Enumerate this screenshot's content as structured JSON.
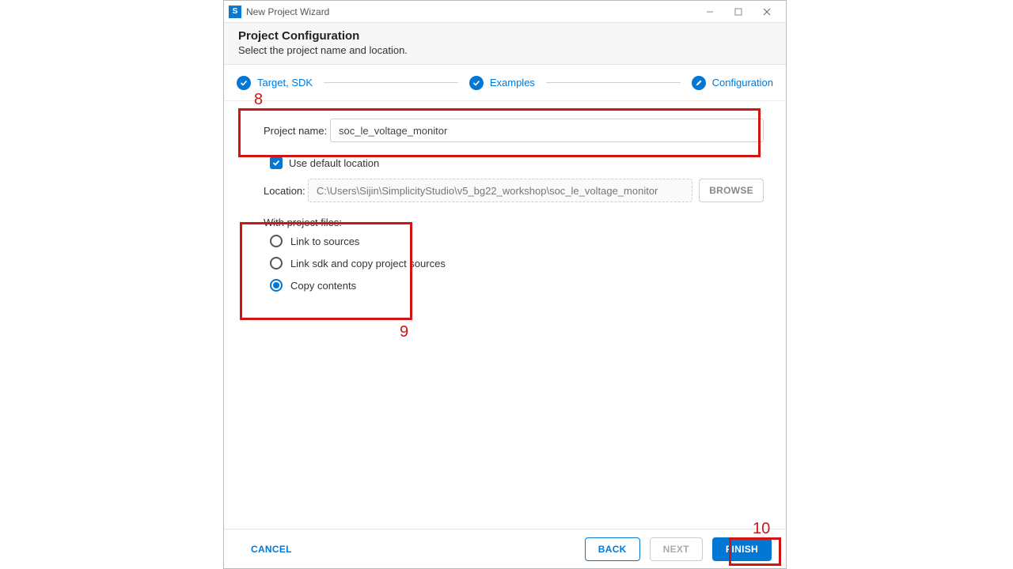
{
  "window": {
    "title": "New Project Wizard"
  },
  "header": {
    "title": "Project Configuration",
    "subtitle": "Select the project name and location."
  },
  "stepper": {
    "step1": "Target, SDK",
    "step2": "Examples",
    "step3": "Configuration"
  },
  "form": {
    "project_name_label": "Project name:",
    "project_name_value": "soc_le_voltage_monitor",
    "use_default_location_label": "Use default location",
    "use_default_location_checked": true,
    "location_label": "Location:",
    "location_value": "C:\\Users\\Sijin\\SimplicityStudio\\v5_bg22_workshop\\soc_le_voltage_monitor",
    "browse_label": "BROWSE",
    "project_files_label": "With project files:",
    "radio_link_sources": "Link to sources",
    "radio_link_sdk": "Link sdk and copy project sources",
    "radio_copy_contents": "Copy contents",
    "selected_radio": "copy_contents"
  },
  "footer": {
    "cancel": "CANCEL",
    "back": "BACK",
    "next": "NEXT",
    "finish": "FINISH"
  },
  "annotations": {
    "a8": "8",
    "a9": "9",
    "a10": "10"
  },
  "colors": {
    "accent": "#0277d4",
    "annotation": "#d01515"
  }
}
